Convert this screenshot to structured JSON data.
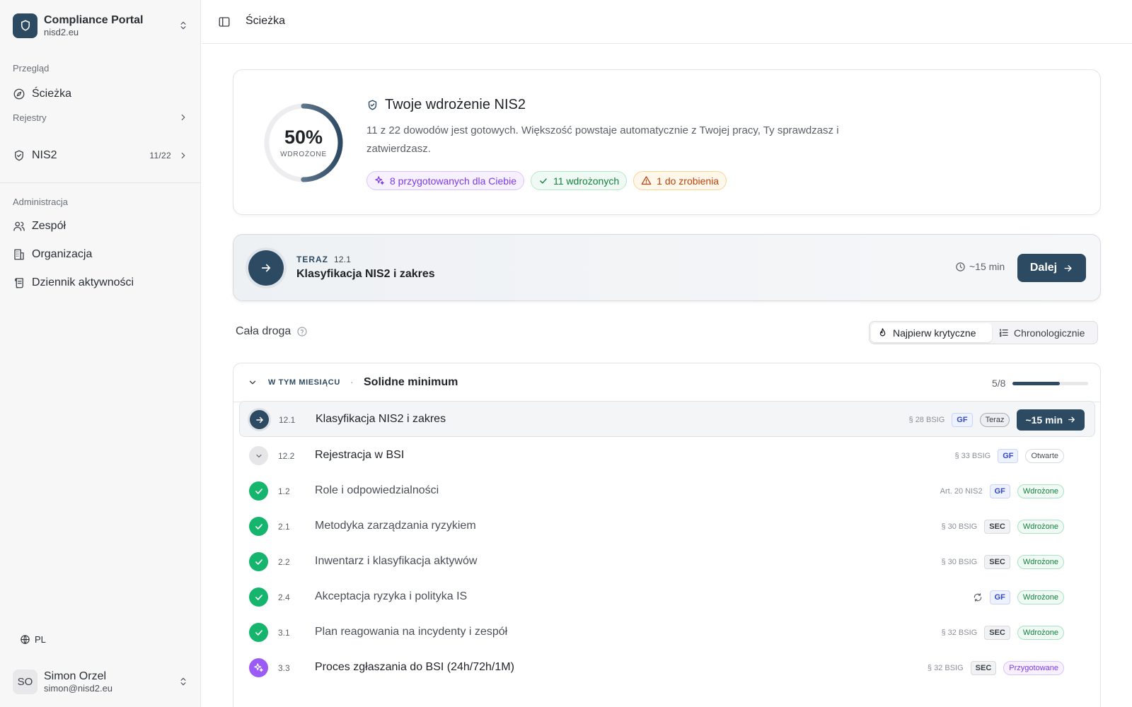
{
  "sidebar": {
    "brand": {
      "name": "Compliance Portal",
      "domain": "nisd2.eu"
    },
    "overview_label": "Przegląd",
    "path_item": "Ścieżka",
    "registers_label": "Rejestry",
    "nis2_item": {
      "label": "NIS2",
      "count": "11/22"
    },
    "admin_label": "Administracja",
    "admin_items": [
      "Zespół",
      "Organizacja",
      "Dziennik aktywności"
    ],
    "language": "PL",
    "user": {
      "initials": "SO",
      "name": "Simon Orzel",
      "email": "simon@nisd2.eu"
    }
  },
  "header": {
    "title": "Ścieżka"
  },
  "hero": {
    "progress_percent": 50,
    "progress_label": "50%",
    "progress_caption": "WDROŻONE",
    "title": "Twoje wdrożenie NIS2",
    "description": "11 z 22 dowodów jest gotowych. Większość powstaje automatycznie z Twojej pracy, Ty sprawdzasz i zatwierdzasz.",
    "chips": {
      "prepared": "8 przygotowanych dla Ciebie",
      "implemented": "11 wdrożonych",
      "todo": "1 do zrobienia"
    }
  },
  "now": {
    "kicker": "TERAZ",
    "number": "12.1",
    "title": "Klasyfikacja NIS2 i zakres",
    "time": "~15 min",
    "button": "Dalej"
  },
  "path": {
    "title": "Cała droga",
    "sort_critical": "Najpierw krytyczne",
    "sort_chrono": "Chronologicznie"
  },
  "group": {
    "kicker": "W TYM MIESIĄCU",
    "separator": "·",
    "title": "Solidne minimum",
    "count": "5/8",
    "progress_fraction": 0.625
  },
  "rows": [
    {
      "num": "12.1",
      "title": "Klasyfikacja NIS2 i zakres",
      "ref": "§ 28 BSIG",
      "tag": "GF",
      "status_label": "Teraz",
      "action": "~15 min"
    },
    {
      "num": "12.2",
      "title": "Rejestracja w BSI",
      "ref": "§ 33 BSIG",
      "tag": "GF",
      "status_label": "Otwarte"
    },
    {
      "num": "1.2",
      "title": "Role i odpowiedzialności",
      "ref": "Art. 20 NIS2",
      "tag": "GF",
      "status_label": "Wdrożone"
    },
    {
      "num": "2.1",
      "title": "Metodyka zarządzania ryzykiem",
      "ref": "§ 30 BSIG",
      "tag": "SEC",
      "status_label": "Wdrożone"
    },
    {
      "num": "2.2",
      "title": "Inwentarz i klasyfikacja aktywów",
      "ref": "§ 30 BSIG",
      "tag": "SEC",
      "status_label": "Wdrożone"
    },
    {
      "num": "2.4",
      "title": "Akceptacja ryzyka i polityka IS",
      "tag": "GF",
      "status_label": "Wdrożone",
      "icon": "refresh-icon"
    },
    {
      "num": "3.1",
      "title": "Plan reagowania na incydenty i zespół",
      "ref": "§ 32 BSIG",
      "tag": "SEC",
      "status_label": "Wdrożone"
    },
    {
      "num": "3.3",
      "title": "Proces zgłaszania do BSI (24h/72h/1M)",
      "ref": "§ 32 BSIG",
      "tag": "SEC",
      "status_label": "Przygotowane"
    }
  ],
  "colors": {
    "primary": "#2d4a63",
    "done": "#16b56d",
    "prepared": "#9b5cf6",
    "todo": "#c2410c"
  }
}
